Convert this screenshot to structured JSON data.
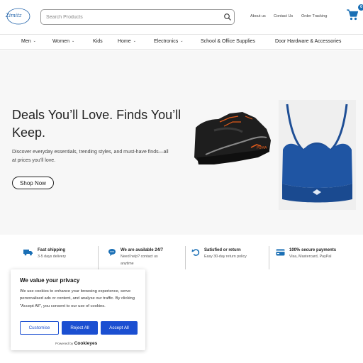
{
  "header": {
    "logo_text": "Zimitz",
    "search_placeholder": "Search Products",
    "links": [
      "About us",
      "Contact Us",
      "Order Tracking"
    ],
    "cart_count": "0"
  },
  "nav": {
    "items": [
      "Men",
      "Women",
      "Kids",
      "Home",
      "Electronics",
      "School & Office Supplies",
      "Door Hardware & Accessories"
    ]
  },
  "hero": {
    "title": "Deals You’ll Love. Finds You’ll Keep.",
    "subtitle": "Discover everyday essentials, trending styles, and must-have finds—all at prices you’ll love.",
    "cta": "Shop Now"
  },
  "features": [
    {
      "icon": "truck-icon",
      "title": "Fast shipping",
      "desc": "3-5 days delivery"
    },
    {
      "icon": "chat-icon",
      "title": "We are available 24/7",
      "desc": "Need help? contact us anytime"
    },
    {
      "icon": "return-icon",
      "title": "Satisfied or return",
      "desc": "Easy 30-day return policy"
    },
    {
      "icon": "card-icon",
      "title": "100% secure payments",
      "desc": "Visa, Mastercard, PayPal"
    }
  ],
  "cookie": {
    "title": "We value your privacy",
    "text": "We use cookies to enhance your browsing experience, serve personalised ads or content, and analyse our traffic. By clicking \"Accept All\", you consent to our use of cookies.",
    "customise": "Customise",
    "reject": "Reject All",
    "accept": "Accept All",
    "powered_by": "Powered by",
    "brand": "Cookieyes"
  },
  "colors": {
    "accent": "#1b4fd1",
    "brand_blue": "#1a6fb5",
    "hero_bg": "#f7f7f7"
  }
}
